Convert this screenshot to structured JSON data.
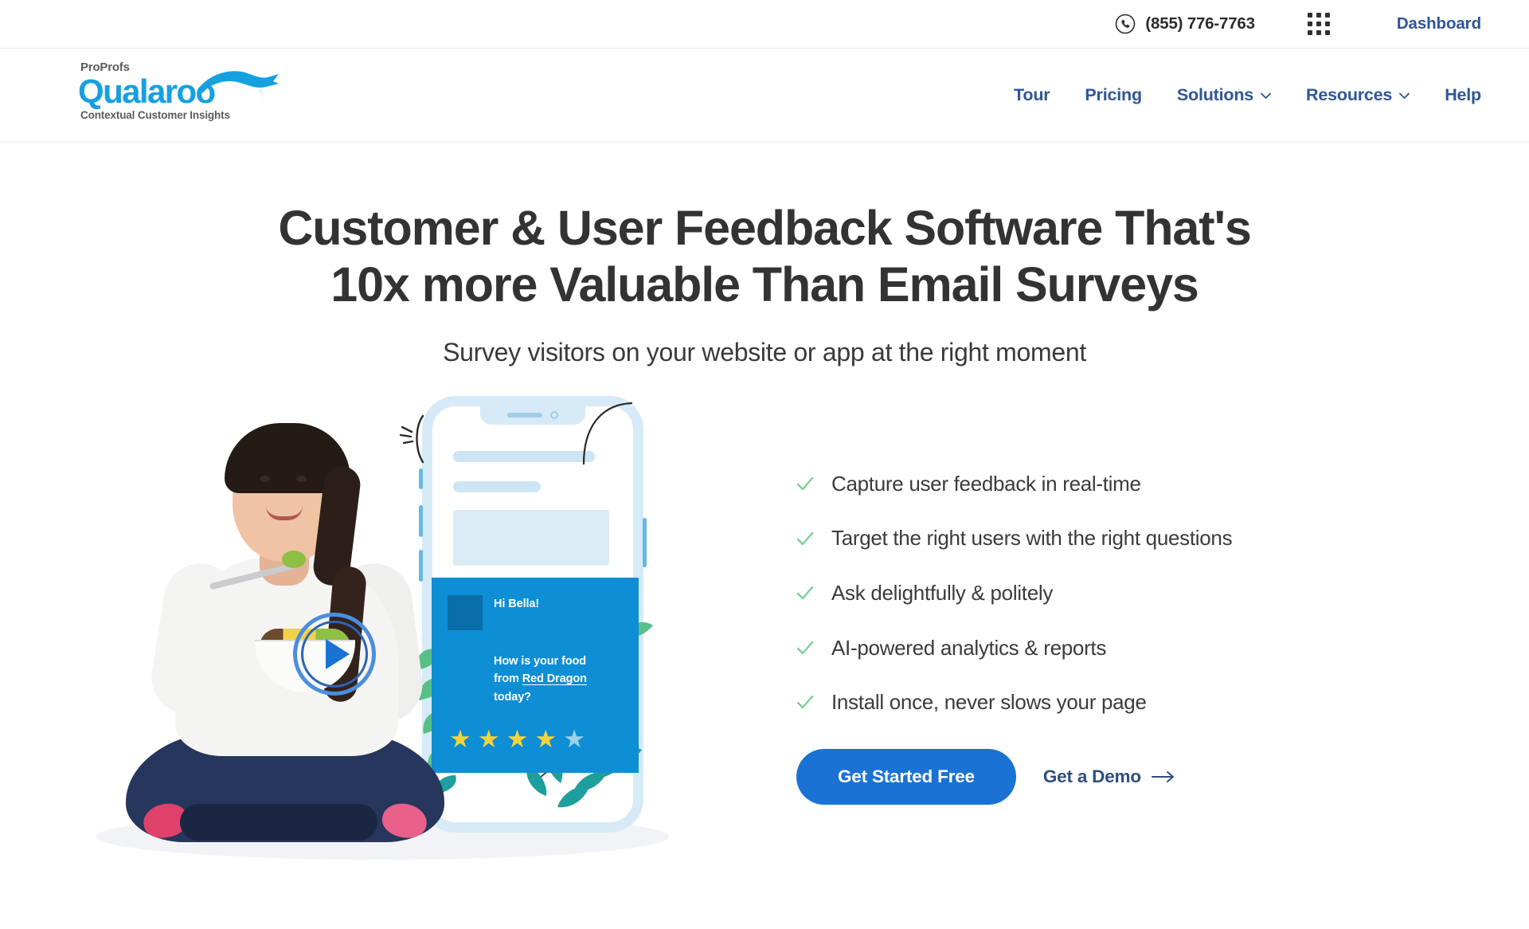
{
  "topbar": {
    "phone_icon": "phone-circle-icon",
    "phone_number": "(855) 776-7763",
    "apps_icon": "apps-grid-icon",
    "dashboard_label": "Dashboard"
  },
  "logo": {
    "top_text": "ProProfs",
    "brand": "Qualaroo",
    "tagline": "Contextual Customer Insights",
    "brand_color": "#16a0e0",
    "mark": "kangaroo-swoosh-icon"
  },
  "nav": {
    "items": [
      {
        "label": "Tour",
        "has_dropdown": false
      },
      {
        "label": "Pricing",
        "has_dropdown": false
      },
      {
        "label": "Solutions",
        "has_dropdown": true
      },
      {
        "label": "Resources",
        "has_dropdown": true
      },
      {
        "label": "Help",
        "has_dropdown": false
      }
    ],
    "link_color": "#2f5597"
  },
  "hero": {
    "title_line1": "Customer & User Feedback Software That's",
    "title_line2": "10x more Valuable Than Email Surveys",
    "subtitle": "Survey visitors on your website or app at the right moment"
  },
  "features": {
    "items": [
      {
        "label": "Capture user feedback in real-time"
      },
      {
        "label": "Target the right users with the right questions"
      },
      {
        "label": "Ask delightfully & politely"
      },
      {
        "label": "AI-powered analytics & reports"
      },
      {
        "label": "Install once, never slows your page"
      }
    ],
    "check_color": "#77d094"
  },
  "cta": {
    "primary_label": "Get Started Free",
    "primary_color": "#1a73d4",
    "secondary_label": "Get a Demo",
    "secondary_icon": "arrow-right-icon"
  },
  "illustration": {
    "play_button_icon": "play-button-icon",
    "woman_photo": "woman-eating-salad-photo",
    "phone_mockup": "smartphone-mockup",
    "leaf_decoration": "fern-leaf-decoration",
    "survey_card": {
      "avatar": "survey-avatar-placeholder",
      "greeting": "Hi Bella!",
      "question_line1": "How is your food",
      "question_before": "from ",
      "question_highlight": "Red Dragon",
      "question_after": " today?",
      "card_color": "#0e8ed4",
      "rating_filled": 4,
      "rating_total": 5,
      "star_color": "#f5d43a"
    }
  }
}
